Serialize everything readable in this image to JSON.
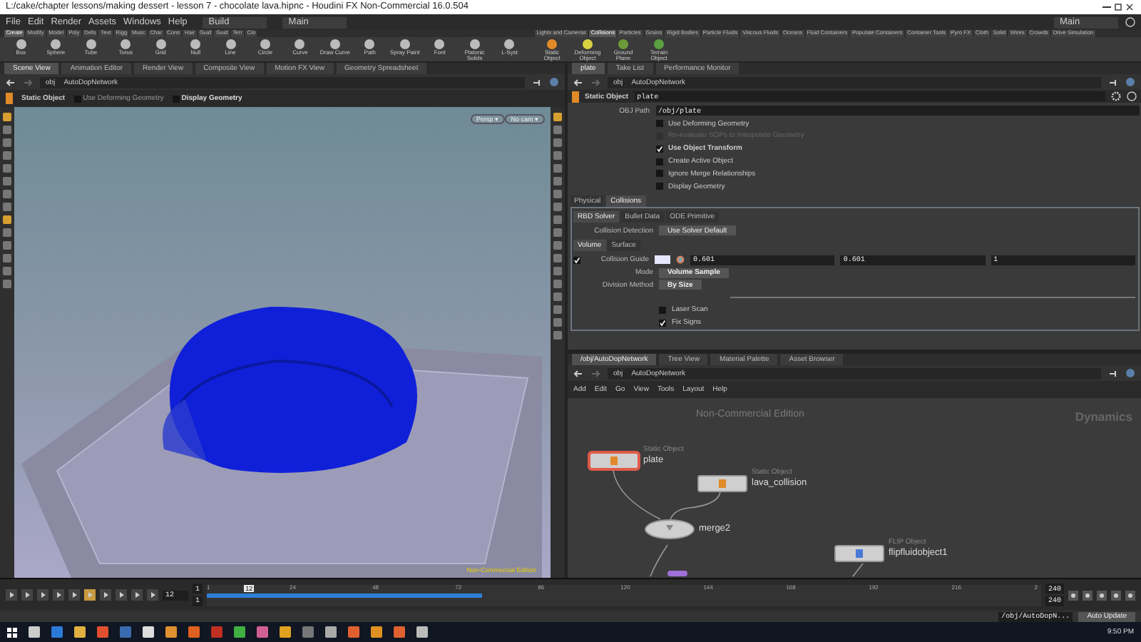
{
  "window": {
    "title": "L:/cake/chapter lessons/making dessert - lesson 7 - chocolate lava.hipnc - Houdini FX Non-Commercial 16.0.504"
  },
  "menu": [
    "File",
    "Edit",
    "Render",
    "Assets",
    "Windows",
    "Help"
  ],
  "desktops": [
    "Build",
    "Main"
  ],
  "right_desktop": "Main",
  "shelf_left": {
    "tabs": [
      {
        "label": "Create",
        "selected": true
      },
      {
        "label": "Modify",
        "selected": false
      },
      {
        "label": "Model",
        "selected": false
      },
      {
        "label": "Poly",
        "selected": false
      },
      {
        "label": "Defo",
        "selected": false
      },
      {
        "label": "Text",
        "selected": false
      },
      {
        "label": "Rigg",
        "selected": false
      },
      {
        "label": "Musc",
        "selected": false
      },
      {
        "label": "Char",
        "selected": false
      },
      {
        "label": "Cons",
        "selected": false
      },
      {
        "label": "Hair",
        "selected": false
      },
      {
        "label": "Guid",
        "selected": false
      },
      {
        "label": "Guid",
        "selected": false
      },
      {
        "label": "Terr",
        "selected": false
      },
      {
        "label": "Clo",
        "selected": false
      }
    ],
    "tools": [
      "Box",
      "Sphere",
      "Tube",
      "Torus",
      "Grid",
      "Null",
      "Line",
      "Circle",
      "Curve",
      "Draw Curve",
      "Path",
      "Spray Paint",
      "Font",
      "Platonic Solids",
      "L-Syst"
    ]
  },
  "shelf_right": {
    "tabs": [
      {
        "label": "Lights and Cameras",
        "selected": false
      },
      {
        "label": "Collisions",
        "selected": true
      },
      {
        "label": "Particles",
        "selected": false
      },
      {
        "label": "Grains",
        "selected": false
      },
      {
        "label": "Rigid Bodies",
        "selected": false
      },
      {
        "label": "Particle Fluids",
        "selected": false
      },
      {
        "label": "Viscous Fluids",
        "selected": false
      },
      {
        "label": "Oceans",
        "selected": false
      },
      {
        "label": "Fluid Containers",
        "selected": false
      },
      {
        "label": "Populate Containers",
        "selected": false
      },
      {
        "label": "Container Tools",
        "selected": false
      },
      {
        "label": "Pyro FX",
        "selected": false
      },
      {
        "label": "Cloth",
        "selected": false
      },
      {
        "label": "Solid",
        "selected": false
      },
      {
        "label": "Wires",
        "selected": false
      },
      {
        "label": "Crowds",
        "selected": false
      },
      {
        "label": "Drive Simulation",
        "selected": false
      }
    ],
    "tools": [
      "Static Object",
      "Deforming Object",
      "Ground Plane",
      "Terrain Object"
    ]
  },
  "scene_pane": {
    "tabs": [
      {
        "label": "Scene View",
        "selected": true
      },
      {
        "label": "Animation Editor",
        "selected": false
      },
      {
        "label": "Render View",
        "selected": false
      },
      {
        "label": "Composite View",
        "selected": false
      },
      {
        "label": "Motion FX View",
        "selected": false
      },
      {
        "label": "Geometry Spreadsheet",
        "selected": false
      }
    ],
    "path": [
      "obj",
      "AutoDopNetwork"
    ],
    "operation": "Static Object",
    "options": [
      {
        "label": "Use Deforming Geometry",
        "checked": false,
        "bold": false
      },
      {
        "label": "Display Geometry",
        "checked": false,
        "bold": true
      }
    ],
    "camera_menus": [
      "Persp ▾",
      "No cam ▾"
    ],
    "edition_label": "Non-Commercial Edition"
  },
  "params_pane": {
    "tabs": [
      {
        "label": "plate",
        "selected": true
      },
      {
        "label": "Take List",
        "selected": false
      },
      {
        "label": "Performance Monitor",
        "selected": false
      }
    ],
    "path": [
      "obj",
      "AutoDopNetwork"
    ],
    "node_type": "Static Object",
    "node_name": "plate",
    "obj_path_label": "OBJ Path",
    "obj_path": "/obj/plate",
    "toggles": [
      {
        "label": "Use Deforming Geometry",
        "checked": false,
        "disabled": false
      },
      {
        "label": "Re-evaluate SOPs to Interpolate Geometry",
        "checked": false,
        "disabled": true
      },
      {
        "label": "Use Object Transform",
        "checked": true,
        "disabled": false
      },
      {
        "label": "Create Active Object",
        "checked": false,
        "disabled": false
      },
      {
        "label": "Ignore Merge Relationships",
        "checked": false,
        "disabled": false
      },
      {
        "label": "Display Geometry",
        "checked": false,
        "disabled": false
      }
    ],
    "tabs_main": [
      {
        "label": "Physical",
        "selected": false
      },
      {
        "label": "Collisions",
        "selected": true
      }
    ],
    "tabs_solver": [
      {
        "label": "RBD Solver",
        "selected": true
      },
      {
        "label": "Bullet Data",
        "selected": false
      },
      {
        "label": "ODE Primitive",
        "selected": false
      }
    ],
    "collision_detection": {
      "label": "Collision Detection",
      "value": "Use Solver Default"
    },
    "tabs_volume": [
      {
        "label": "Volume",
        "selected": true
      },
      {
        "label": "Surface",
        "selected": false
      }
    ],
    "collision_guide": {
      "label": "Collision Guide",
      "checked": true,
      "color": "#e6e6ff",
      "values": [
        "0.601",
        "0.601",
        "1"
      ]
    },
    "menus": [
      {
        "label": "Mode",
        "value": "Volume Sample"
      },
      {
        "label": "Division Method",
        "value": "By Size"
      }
    ],
    "bottom_toggles": [
      {
        "label": "Laser Scan",
        "checked": false
      },
      {
        "label": "Fix Signs",
        "checked": true
      }
    ]
  },
  "network_pane": {
    "tabs": [
      {
        "label": "/obj/AutoDopNetwork",
        "selected": true
      },
      {
        "label": "Tree View",
        "selected": false
      },
      {
        "label": "Material Palette",
        "selected": false
      },
      {
        "label": "Asset Browser",
        "selected": false
      }
    ],
    "path": [
      "obj",
      "AutoDopNetwork"
    ],
    "menu": [
      "Add",
      "Edit",
      "Go",
      "View",
      "Tools",
      "Layout",
      "Help"
    ],
    "edition_label": "Non-Commercial Edition",
    "context_label": "Dynamics",
    "nodes": [
      {
        "type_label": "Static Object",
        "name": "plate",
        "kind": "object",
        "selected": true
      },
      {
        "type_label": "Static Object",
        "name": "lava_collision",
        "kind": "object",
        "selected": false
      },
      {
        "name": "merge2",
        "kind": "merge",
        "selected": false
      },
      {
        "type_label": "FLIP Object",
        "name": "flipfluidobject1",
        "kind": "flip",
        "selected": false
      }
    ]
  },
  "timeline": {
    "frame": "12",
    "start": [
      "1",
      "1"
    ],
    "end": [
      "240",
      "240"
    ],
    "ticks": [
      "1",
      "12",
      "24",
      "48",
      "72",
      "96",
      "120",
      "144",
      "168",
      "192",
      "216",
      "2"
    ]
  },
  "status_bar": {
    "path": "/obj/AutoDopN...",
    "update_mode": "Auto Update"
  },
  "taskbar": {
    "time": "9:50 PM"
  }
}
